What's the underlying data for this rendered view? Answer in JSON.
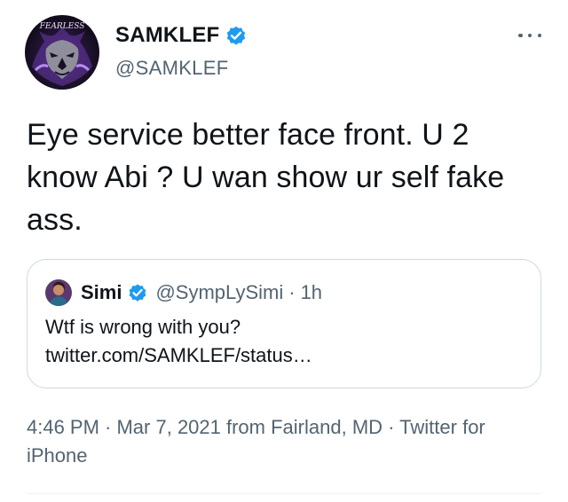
{
  "author": {
    "name": "SAMKLEF",
    "handle": "@SAMKLEF",
    "avatar_text": "FEARLESS"
  },
  "tweet": {
    "text": "Eye service better face front. U 2 know Abi ? U wan show ur self fake ass."
  },
  "quoted_tweet": {
    "name": "Simi",
    "handle": "@SympLySimi",
    "separator": "·",
    "time": "1h",
    "lines": [
      "Wtf is wrong with you?",
      "twitter.com/SAMKLEF/status…"
    ]
  },
  "meta": {
    "text": "4:46 PM · Mar 7, 2021 from Fairland, MD · Twitter for iPhone"
  },
  "colors": {
    "verified": "#1d9bf0",
    "secondary_text": "#536471",
    "primary_text": "#0f1419",
    "border": "#cfd9de"
  },
  "icons": {
    "verified": "verified-badge-icon",
    "more": "more-options-icon"
  }
}
